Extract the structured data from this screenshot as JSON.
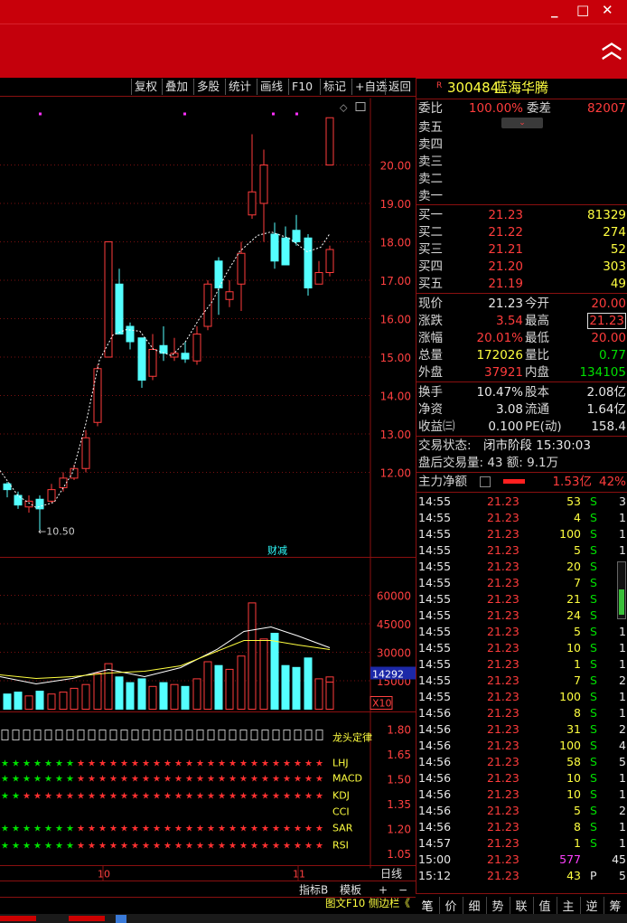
{
  "window": {
    "buttons": [
      "_",
      "□",
      "✕"
    ]
  },
  "toolbar": {
    "items": [
      "复权",
      "叠加",
      "多股",
      "统计",
      "画线",
      "F10",
      "标记",
      "+自选",
      "返回"
    ]
  },
  "stock": {
    "flag": "R",
    "code": "300484",
    "name": "蓝海华腾"
  },
  "order_ratio": {
    "label1": "委比",
    "value1": "100.00%",
    "label2": "委差",
    "value2": "82007"
  },
  "asks": [
    {
      "label": "卖五",
      "price": "",
      "vol": ""
    },
    {
      "label": "卖四",
      "price": "",
      "vol": ""
    },
    {
      "label": "卖三",
      "price": "",
      "vol": ""
    },
    {
      "label": "卖二",
      "price": "",
      "vol": ""
    },
    {
      "label": "卖一",
      "price": "",
      "vol": ""
    }
  ],
  "bids": [
    {
      "label": "买一",
      "price": "21.23",
      "vol": "81329"
    },
    {
      "label": "买二",
      "price": "21.22",
      "vol": "274"
    },
    {
      "label": "买三",
      "price": "21.21",
      "vol": "52"
    },
    {
      "label": "买四",
      "price": "21.20",
      "vol": "303"
    },
    {
      "label": "买五",
      "price": "21.19",
      "vol": "49"
    }
  ],
  "quote": [
    {
      "l1": "现价",
      "v1": "21.23",
      "l2": "今开",
      "v2": "20.00"
    },
    {
      "l1": "涨跌",
      "v1": "3.54",
      "l2": "最高",
      "v2": "21.23"
    },
    {
      "l1": "涨幅",
      "v1": "20.01%",
      "l2": "最低",
      "v2": "20.00"
    },
    {
      "l1": "总量",
      "v1": "172026",
      "l2": "量比",
      "v2": "0.77"
    },
    {
      "l1": "外盘",
      "v1": "37921",
      "l2": "内盘",
      "v2": "134105"
    }
  ],
  "fund": [
    {
      "l1": "换手",
      "v1": "10.47%",
      "l2": "股本",
      "v2": "2.08亿"
    },
    {
      "l1": "净资",
      "v1": "3.08",
      "l2": "流通",
      "v2": "1.64亿"
    },
    {
      "l1": "收益㈢",
      "v1": "0.100",
      "l2": "PE(动)",
      "v2": "158.4"
    }
  ],
  "status": {
    "line1_label": "交易状态:",
    "line1_value": "闭市阶段 15:30:03",
    "line2": "盘后交易量: 43  额: 9.1万"
  },
  "main_force": {
    "label": "主力净额",
    "value": "1.53亿",
    "pct": "42%"
  },
  "trades": [
    {
      "t": "14:55",
      "p": "21.23",
      "v": "53",
      "f": "S",
      "n": "3"
    },
    {
      "t": "14:55",
      "p": "21.23",
      "v": "4",
      "f": "S",
      "n": "1"
    },
    {
      "t": "14:55",
      "p": "21.23",
      "v": "100",
      "f": "S",
      "n": "1"
    },
    {
      "t": "14:55",
      "p": "21.23",
      "v": "5",
      "f": "S",
      "n": "1"
    },
    {
      "t": "14:55",
      "p": "21.23",
      "v": "20",
      "f": "S",
      "n": "1"
    },
    {
      "t": "14:55",
      "p": "21.23",
      "v": "7",
      "f": "S",
      "n": "1"
    },
    {
      "t": "14:55",
      "p": "21.23",
      "v": "21",
      "f": "S",
      "n": "1"
    },
    {
      "t": "14:55",
      "p": "21.23",
      "v": "24",
      "f": "S",
      "n": "1"
    },
    {
      "t": "14:55",
      "p": "21.23",
      "v": "5",
      "f": "S",
      "n": "1"
    },
    {
      "t": "14:55",
      "p": "21.23",
      "v": "10",
      "f": "S",
      "n": "1"
    },
    {
      "t": "14:55",
      "p": "21.23",
      "v": "1",
      "f": "S",
      "n": "1"
    },
    {
      "t": "14:55",
      "p": "21.23",
      "v": "7",
      "f": "S",
      "n": "2"
    },
    {
      "t": "14:55",
      "p": "21.23",
      "v": "100",
      "f": "S",
      "n": "1"
    },
    {
      "t": "14:56",
      "p": "21.23",
      "v": "8",
      "f": "S",
      "n": "1"
    },
    {
      "t": "14:56",
      "p": "21.23",
      "v": "31",
      "f": "S",
      "n": "2"
    },
    {
      "t": "14:56",
      "p": "21.23",
      "v": "100",
      "f": "S",
      "n": "4"
    },
    {
      "t": "14:56",
      "p": "21.23",
      "v": "58",
      "f": "S",
      "n": "5"
    },
    {
      "t": "14:56",
      "p": "21.23",
      "v": "10",
      "f": "S",
      "n": "1"
    },
    {
      "t": "14:56",
      "p": "21.23",
      "v": "10",
      "f": "S",
      "n": "1"
    },
    {
      "t": "14:56",
      "p": "21.23",
      "v": "5",
      "f": "S",
      "n": "2"
    },
    {
      "t": "14:56",
      "p": "21.23",
      "v": "8",
      "f": "S",
      "n": "1"
    },
    {
      "t": "14:57",
      "p": "21.23",
      "v": "1",
      "f": "S",
      "n": "1"
    },
    {
      "t": "15:00",
      "p": "21.23",
      "v": "577",
      "f": "",
      "n": "45"
    },
    {
      "t": "15:12",
      "p": "21.23",
      "v": "43",
      "f": "P",
      "n": "5"
    }
  ],
  "bottom_tabs": [
    "笔",
    "价",
    "细",
    "势",
    "联",
    "值",
    "主",
    "逆",
    "筹"
  ],
  "chart_labels": {
    "price_ticks": [
      "20.00",
      "19.00",
      "18.00",
      "17.00",
      "16.00",
      "15.00",
      "14.00",
      "13.00",
      "12.00"
    ],
    "low_label": "←10.50",
    "fin_badge": "财减",
    "vol_ticks": [
      "60000",
      "45000",
      "30000",
      "15000"
    ],
    "vol_marker": "14292",
    "vol_unit": "X10",
    "ind_ticks": [
      "1.80",
      "1.65",
      "1.50",
      "1.35",
      "1.20",
      "1.05"
    ],
    "signals": [
      "龙头定律",
      "LHJ",
      "MACD",
      "KDJ",
      "CCI",
      "SAR",
      "RSI"
    ],
    "date_labels": [
      "10",
      "11"
    ],
    "period_label": "日线",
    "tabs": [
      "指标B",
      "模板",
      "+",
      "−"
    ],
    "footer": "图文F10 侧边栏《"
  },
  "colors": {
    "up": "#ff3c3c",
    "down": "#54ffff",
    "bg": "#000000",
    "grid": "#8a1010"
  }
}
